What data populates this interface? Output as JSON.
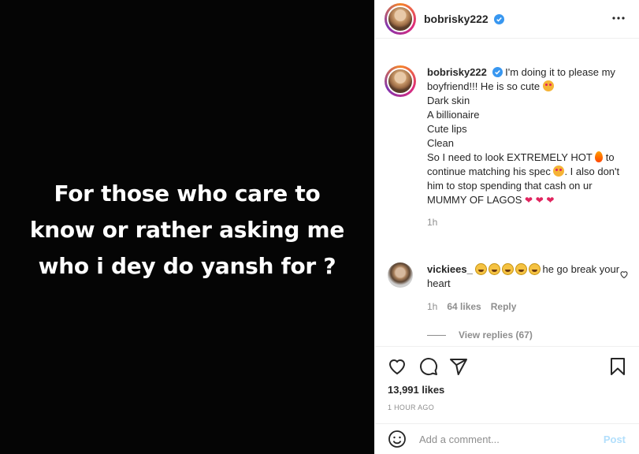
{
  "post_image": {
    "text": "For those who care to\nknow or rather asking me\nwho i dey do yansh for ?"
  },
  "header": {
    "username": "bobrisky222",
    "verified_icon": "verified-badge-icon",
    "more_icon": "more-options-icon"
  },
  "caption": {
    "username": "bobrisky222",
    "line1": "I'm doing it to please my boyfriend!!! He is so cute",
    "lines": [
      "Dark skin",
      "A billionaire",
      "Cute lips",
      "Clean"
    ],
    "line_hot_a": "So I need to look EXTREMELY HOT",
    "line_hot_b": "to continue matching his spec",
    "line_hot_c": ". I also don't him to stop spending that cash on ur MUMMY OF LAGOS",
    "time": "1h"
  },
  "comment": {
    "username": "vickiees_",
    "text": "he go break your heart",
    "time": "1h",
    "likes": "64 likes",
    "reply": "Reply",
    "view_replies": "View replies (67)"
  },
  "actions": {
    "likes": "13,991 likes",
    "time": "1 HOUR AGO"
  },
  "add_comment": {
    "placeholder": "Add a comment...",
    "post_label": "Post"
  },
  "colors": {
    "verified": "#3897f0",
    "heart": "#e0245e",
    "post_button": "#b2dffc",
    "muted": "#8e8e8e"
  }
}
